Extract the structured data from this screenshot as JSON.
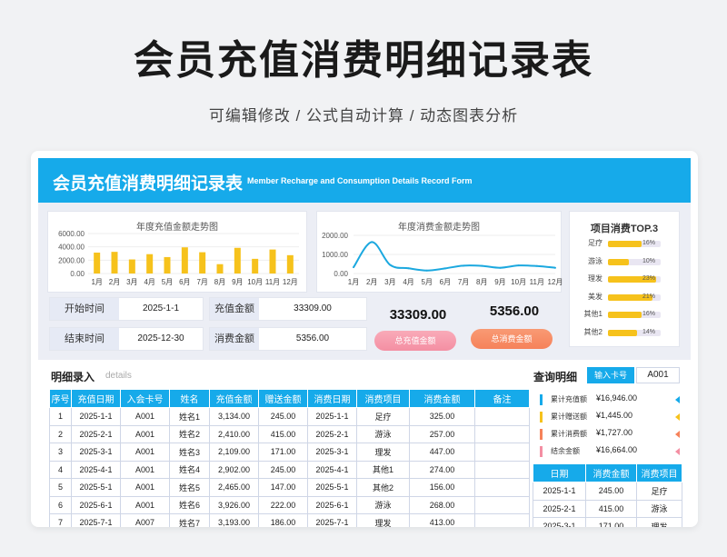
{
  "page": {
    "title": "会员充值消费明细记录表",
    "subtitle": "可编辑修改 /  公式自动计算  /  动态图表分析"
  },
  "banner": {
    "title": "会员充值消费明细记录表",
    "subtitle_en": "Member Recharge and Consumption Details Record Form"
  },
  "colors": {
    "accent": "#16aaea",
    "bar": "#f6c21c",
    "line": "#1ba8df",
    "pink_button": "#f48fa3",
    "orange_button": "#f6825a"
  },
  "chart_data": [
    {
      "type": "bar",
      "title": "年度充值金额走势图",
      "categories": [
        "1月",
        "2月",
        "3月",
        "4月",
        "5月",
        "6月",
        "7月",
        "8月",
        "9月",
        "10月",
        "11月",
        "12月"
      ],
      "values": [
        3134,
        3250,
        2109,
        2902,
        2465,
        3926,
        3193,
        1400,
        3850,
        2200,
        3600,
        2750
      ],
      "ylim": [
        0,
        6000
      ],
      "yticks": [
        "0.00",
        "2000.00",
        "4000.00",
        "6000.00"
      ]
    },
    {
      "type": "line",
      "title": "年度消费金额走势图",
      "categories": [
        "1月",
        "2月",
        "3月",
        "4月",
        "5月",
        "6月",
        "7月",
        "8月",
        "9月",
        "10月",
        "11月",
        "12月"
      ],
      "values": [
        325,
        1650,
        447,
        274,
        156,
        268,
        413,
        400,
        300,
        420,
        390,
        300
      ],
      "ylim": [
        0,
        2000
      ],
      "yticks": [
        "0.00",
        "1000.00",
        "2000.00"
      ]
    }
  ],
  "top3": {
    "title": "项目消费TOP.3",
    "items": [
      {
        "label": "足疗",
        "pct": "16%",
        "value": 16
      },
      {
        "label": "游泳",
        "pct": "10%",
        "value": 10
      },
      {
        "label": "理发",
        "pct": "23%",
        "value": 23
      },
      {
        "label": "美发",
        "pct": "21%",
        "value": 21
      },
      {
        "label": "其他1",
        "pct": "16%",
        "value": 16
      },
      {
        "label": "其他2",
        "pct": "14%",
        "value": 14
      }
    ]
  },
  "summary": {
    "start_label": "开始时间",
    "start_value": "2025-1-1",
    "end_label": "结束时间",
    "end_value": "2025-12-30",
    "recharge_label": "充值金额",
    "recharge_value": "33309.00",
    "consume_label": "消费金额",
    "consume_value": "5356.00",
    "total_recharge": "33309.00",
    "total_consume": "5356.00",
    "total_recharge_button": "总充值金额",
    "total_consume_button": "总消费金额"
  },
  "details": {
    "title": "明细录入",
    "hint": "details",
    "columns": [
      "序号",
      "充值日期",
      "入会卡号",
      "姓名",
      "充值金额",
      "赠送金额",
      "消费日期",
      "消费项目",
      "消费金额",
      "备注"
    ],
    "rows": [
      [
        "1",
        "2025-1-1",
        "A001",
        "姓名1",
        "3,134.00",
        "245.00",
        "2025-1-1",
        "足疗",
        "325.00",
        ""
      ],
      [
        "2",
        "2025-2-1",
        "A001",
        "姓名2",
        "2,410.00",
        "415.00",
        "2025-2-1",
        "游泳",
        "257.00",
        ""
      ],
      [
        "3",
        "2025-3-1",
        "A001",
        "姓名3",
        "2,109.00",
        "171.00",
        "2025-3-1",
        "理发",
        "447.00",
        ""
      ],
      [
        "4",
        "2025-4-1",
        "A001",
        "姓名4",
        "2,902.00",
        "245.00",
        "2025-4-1",
        "其他1",
        "274.00",
        ""
      ],
      [
        "5",
        "2025-5-1",
        "A001",
        "姓名5",
        "2,465.00",
        "147.00",
        "2025-5-1",
        "其他2",
        "156.00",
        ""
      ],
      [
        "6",
        "2025-6-1",
        "A001",
        "姓名6",
        "3,926.00",
        "222.00",
        "2025-6-1",
        "游泳",
        "268.00",
        ""
      ],
      [
        "7",
        "2025-7-1",
        "A007",
        "姓名7",
        "3,193.00",
        "186.00",
        "2025-7-1",
        "理发",
        "413.00",
        ""
      ]
    ]
  },
  "query": {
    "title": "查询明细",
    "input_label": "输入卡号",
    "card": "A001",
    "stats": [
      {
        "label": "累计充值额",
        "value": "¥16,946.00",
        "color": "#16aaea"
      },
      {
        "label": "累计赠送额",
        "value": "¥1,445.00",
        "color": "#f6c21c"
      },
      {
        "label": "累计消费额",
        "value": "¥1,727.00",
        "color": "#f6825a"
      },
      {
        "label": "结余金额",
        "value": "¥16,664.00",
        "color": "#f48fa3"
      }
    ],
    "columns": [
      "日期",
      "消费金额",
      "消费项目"
    ],
    "rows": [
      [
        "2025-1-1",
        "245.00",
        "足疗"
      ],
      [
        "2025-2-1",
        "415.00",
        "游泳"
      ],
      [
        "2025-3-1",
        "171.00",
        "理发"
      ]
    ]
  }
}
